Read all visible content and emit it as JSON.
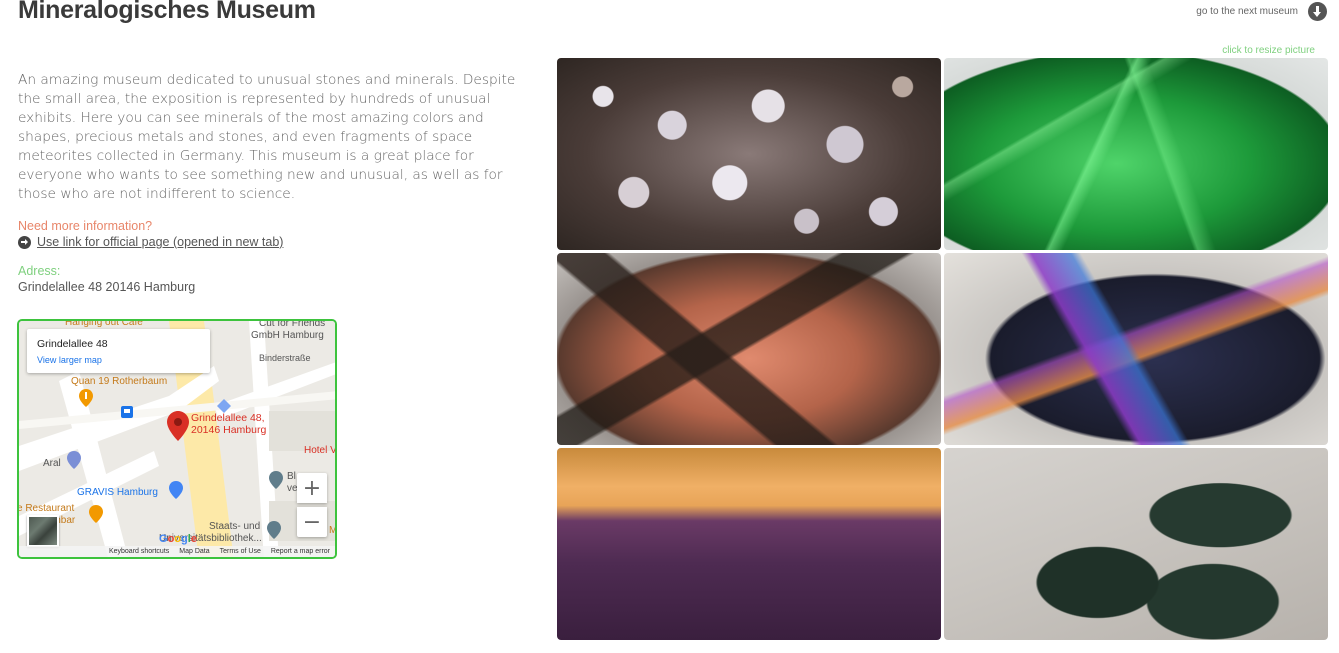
{
  "header": {
    "title": "Mineralogisches Museum",
    "next_museum_label": "go to the next museum"
  },
  "gallery_hint": "click to resize picture",
  "content": {
    "description": "An amazing museum dedicated to unusual stones and minerals. Despite the small area, the exposition is represented by hundreds of unusual exhibits. Here you can see minerals of the most amazing colors and shapes, precious metals and stones, and even fragments of space meteorites collected in Germany. This museum is a great place for everyone who wants to see something new and unusual, as well as for those who are not indifferent to science.",
    "more_info_label": "Need more information?",
    "official_link_label": " Use link for official page (opened in new tab)",
    "adress_label": "Adress:",
    "adress_value": "Grindelallee 48 20146 Hamburg"
  },
  "map": {
    "card_address": "Grindelallee 48",
    "view_larger": "View larger map",
    "pin_label_line1": "Grindelallee 48,",
    "pin_label_line2": "20146 Hamburg",
    "places": {
      "hanging_out_cafe": "Hanging out Cafe",
      "cut_for_friends_1": "Cut for Friends",
      "cut_for_friends_2": "GmbH Hamburg",
      "binderstrasse": "Binderstraße",
      "quan19": "Quan 19 Rotherbaum",
      "hotel": "Hotel V",
      "aral": "Aral",
      "bl": "Bl",
      "ve": "ve",
      "gravis": "GRAVIS Hamburg",
      "restaurant": "e Restaurant",
      "inbar": "inbar",
      "staats1": "Staats- und",
      "staats2": "Universitätsbibliothek...",
      "m_edge": "M"
    },
    "zoom_in": "+",
    "zoom_out": "−",
    "google": "Google",
    "footer": {
      "shortcuts": "Keyboard shortcuts",
      "map_data": "Map Data",
      "terms": "Terms of Use",
      "report": "Report a map error"
    },
    "colors": {
      "border": "#3dc33d",
      "pin": "#d93025",
      "link": "#1a73e8"
    }
  },
  "photos": [
    {
      "icon": "mineral-photo-chalcedony"
    },
    {
      "icon": "mineral-photo-green-crystals"
    },
    {
      "icon": "mineral-photo-orange-calcite"
    },
    {
      "icon": "mineral-photo-iridescent-quartz"
    },
    {
      "icon": "mineral-photo-amethyst-citrine"
    },
    {
      "icon": "mineral-photo-dark-green-stone"
    }
  ],
  "colors": {
    "more_info": "#e8866a",
    "adress_label": "#7fd07f",
    "resize_hint": "#7fd07f"
  }
}
